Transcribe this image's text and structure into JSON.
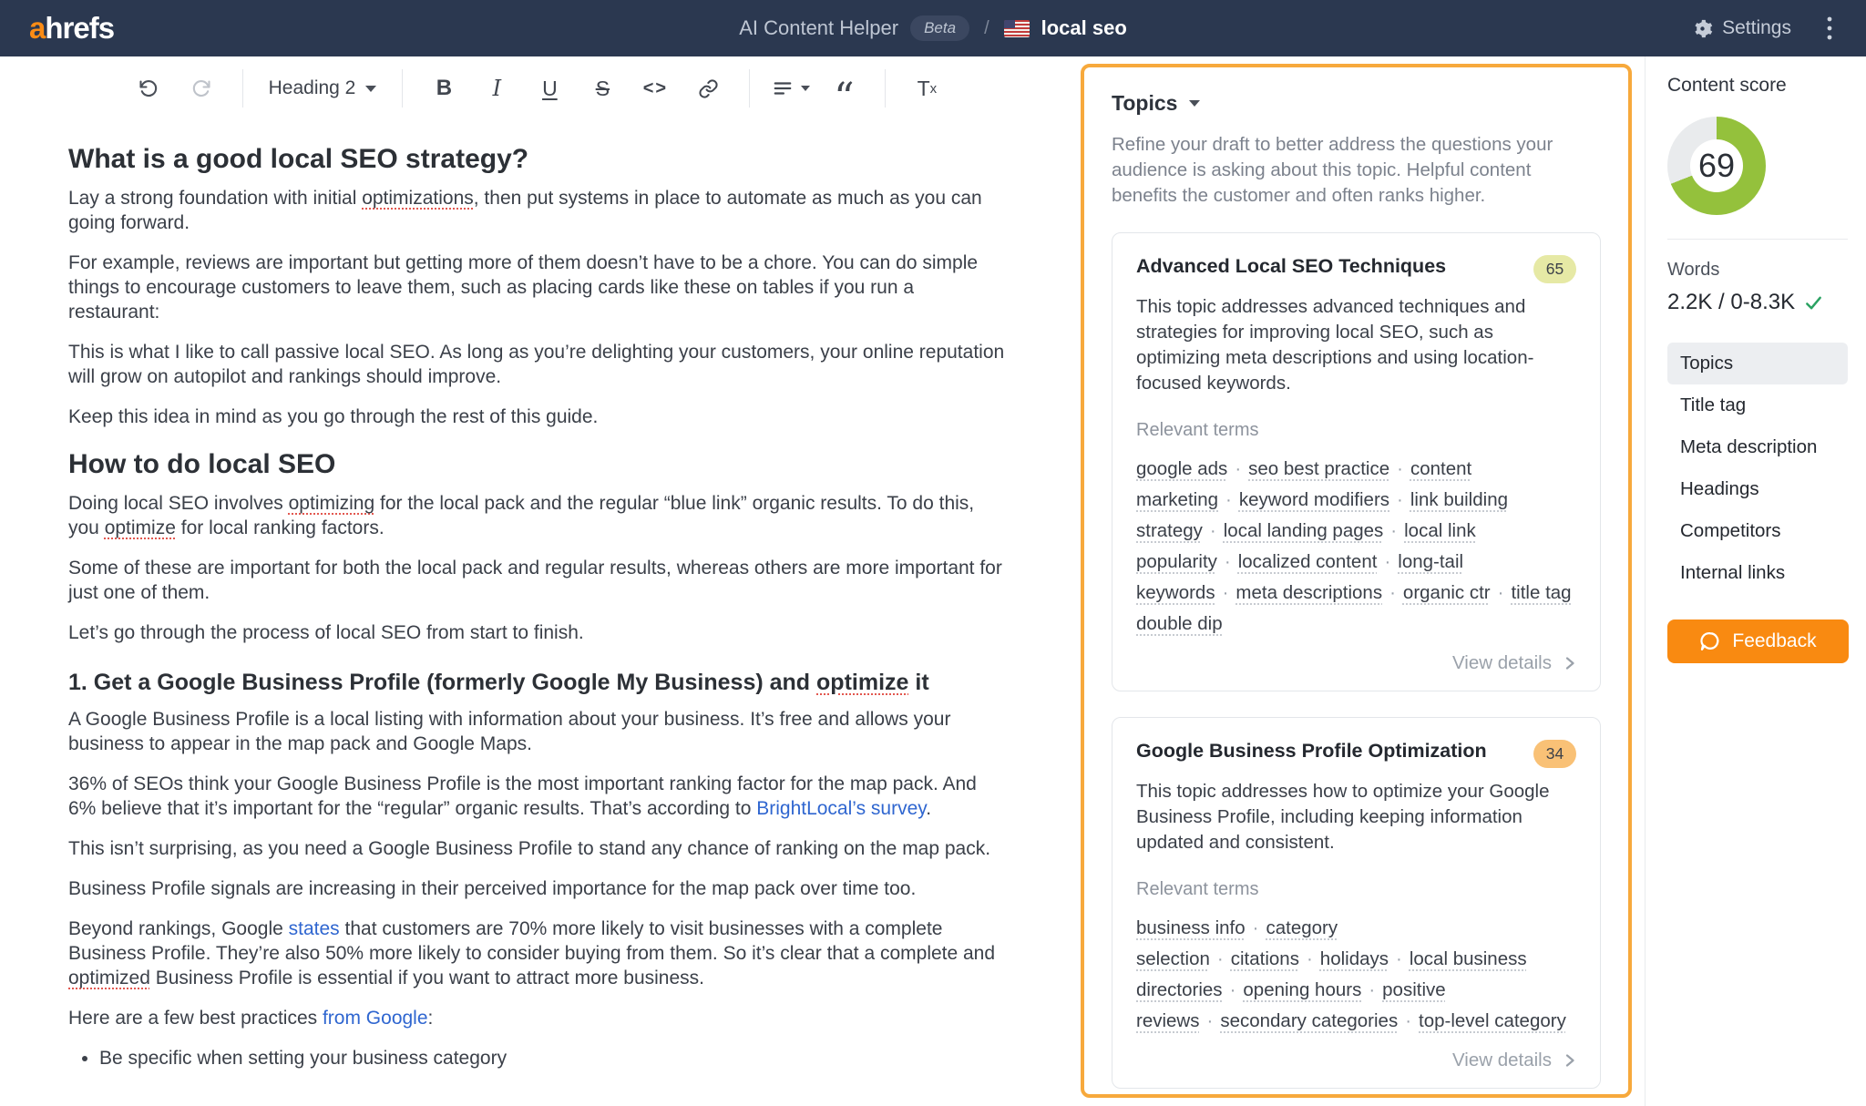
{
  "colors": {
    "navbar_bg": "#2b3850",
    "brand_orange": "#fb8c15",
    "panel_border_orange": "#f7a93c",
    "feedback_orange": "#f98a11",
    "link_blue": "#2f66d0",
    "donut_green": "#94c13c",
    "donut_gray": "#e9ebed",
    "check_green": "#2aa262",
    "spell_red": "#e2574f"
  },
  "navbar": {
    "logo_accent": "a",
    "logo_rest": "hrefs",
    "app_title": "AI Content Helper",
    "beta_label": "Beta",
    "breadcrumb_separator": "/",
    "doc_title": "local seo",
    "settings_label": "Settings"
  },
  "icons": {
    "undo": "undo-arrow-icon",
    "redo": "redo-arrow-icon",
    "heading_caret": "chevron-down-icon",
    "link": "chain-link-icon",
    "align": "align-text-icon",
    "settings": "gear-icon",
    "more": "kebab-menu-icon",
    "words_check": "check-icon",
    "feedback": "speech-bubble-icon",
    "view_details": "chevron-right-icon",
    "flag": "us-flag-icon"
  },
  "toolbar": {
    "heading_label": "Heading 2",
    "bold_glyph": "B",
    "italic_glyph": "I",
    "underline_glyph": "U",
    "strikethrough_glyph": "S",
    "code_glyph": "<>",
    "quote_glyph": "“",
    "clear_format_main": "T",
    "clear_format_sub": "x"
  },
  "article": {
    "blocks": [
      {
        "type": "h2",
        "segments": [
          {
            "t": "What is a good local SEO strategy?"
          }
        ]
      },
      {
        "type": "p",
        "segments": [
          {
            "t": "Lay a strong foundation with initial "
          },
          {
            "t": "optimizations",
            "s": "spell"
          },
          {
            "t": ", then put systems in place to automate as much as you can going forward."
          }
        ]
      },
      {
        "type": "p",
        "segments": [
          {
            "t": "For example, reviews are important but getting more of them doesn’t have to be a chore. You can do simple things to encourage customers to leave them, such as placing cards like these on tables if you run a restaurant:"
          }
        ]
      },
      {
        "type": "p",
        "segments": [
          {
            "t": "This is what I like to call passive local SEO. As long as you’re delighting your customers, your online reputation will grow on autopilot and rankings should improve."
          }
        ]
      },
      {
        "type": "p",
        "segments": [
          {
            "t": "Keep this idea in mind as you go through the rest of this guide."
          }
        ]
      },
      {
        "type": "h2",
        "segments": [
          {
            "t": "How to do local SEO"
          }
        ]
      },
      {
        "type": "p",
        "segments": [
          {
            "t": "Doing local SEO involves "
          },
          {
            "t": "optimizing",
            "s": "spell"
          },
          {
            "t": " for the local pack and the regular “blue link” organic results. To do this, you "
          },
          {
            "t": "optimize",
            "s": "spell"
          },
          {
            "t": " for local ranking factors."
          }
        ]
      },
      {
        "type": "p",
        "segments": [
          {
            "t": "Some of these are important for both the local pack and regular results, whereas others are more important for just one of them."
          }
        ]
      },
      {
        "type": "p",
        "segments": [
          {
            "t": "Let’s go through the process of local SEO from start to finish."
          }
        ]
      },
      {
        "type": "h3",
        "segments": [
          {
            "t": "1. Get a Google Business Profile (formerly Google My Business) and "
          },
          {
            "t": "optimize",
            "s": "spell"
          },
          {
            "t": " it"
          }
        ]
      },
      {
        "type": "p",
        "segments": [
          {
            "t": "A Google Business Profile is a local listing with information about your business. It’s free and allows your business to appear in the map pack and Google Maps."
          }
        ]
      },
      {
        "type": "p",
        "segments": [
          {
            "t": "36% of SEOs think your Google Business Profile is the most important ranking factor for the map pack. And 6% believe that it’s important for the “regular” organic results. That’s according to "
          },
          {
            "t": "BrightLocal’s survey",
            "s": "link"
          },
          {
            "t": "."
          }
        ]
      },
      {
        "type": "p",
        "segments": [
          {
            "t": "This isn’t surprising, as you need a Google Business Profile to stand any chance of ranking on the map pack."
          }
        ]
      },
      {
        "type": "p",
        "segments": [
          {
            "t": "Business Profile signals are increasing in their perceived importance for the map pack over time too."
          }
        ]
      },
      {
        "type": "p",
        "segments": [
          {
            "t": "Beyond rankings, Google "
          },
          {
            "t": "states",
            "s": "link"
          },
          {
            "t": " that customers are 70% more likely to visit businesses with a complete Business Profile. They’re also 50% more likely to consider buying from them. So it’s clear that a complete and "
          },
          {
            "t": "optimized",
            "s": "spell"
          },
          {
            "t": " Business Profile is essential if you want to attract more business."
          }
        ]
      },
      {
        "type": "p",
        "segments": [
          {
            "t": "Here are a few best practices "
          },
          {
            "t": "from Google",
            "s": "link"
          },
          {
            "t": ":"
          }
        ]
      },
      {
        "type": "ul",
        "items": [
          "Be specific when setting your business category"
        ]
      }
    ]
  },
  "topics_panel": {
    "title": "Topics",
    "description": "Refine your draft to better address the questions your audience is asking about this topic. Helpful content benefits the customer and often ranks higher.",
    "cards": [
      {
        "title": "Advanced Local SEO Techniques",
        "score": "65",
        "score_color": "#e6e9a5",
        "description": "This topic addresses advanced techniques and strategies for improving local SEO, such as optimizing meta descriptions and using location-focused keywords.",
        "relevant_terms_label": "Relevant terms",
        "terms": [
          "google ads",
          "seo best practice",
          "content marketing",
          "keyword modifiers",
          "link building strategy",
          "local landing pages",
          "local link popularity",
          "localized content",
          "long-tail keywords",
          "meta descriptions",
          "organic ctr",
          "title tag double dip"
        ],
        "view_details_label": "View details"
      },
      {
        "title": "Google Business Profile Optimization",
        "score": "34",
        "score_color": "#f9c176",
        "description": "This topic addresses how to optimize your Google Business Profile, including keeping information updated and consistent.",
        "relevant_terms_label": "Relevant terms",
        "terms": [
          "business info",
          "category selection",
          "citations",
          "holidays",
          "local business directories",
          "opening hours",
          "positive reviews",
          "secondary categories",
          "top-level category"
        ],
        "view_details_label": "View details"
      }
    ]
  },
  "sidebar": {
    "content_score_label": "Content score",
    "score": 69,
    "words_label": "Words",
    "words_value": "2.2K / 0-8.3K",
    "nav_items": [
      {
        "label": "Topics",
        "active": true
      },
      {
        "label": "Title tag",
        "active": false
      },
      {
        "label": "Meta description",
        "active": false
      },
      {
        "label": "Headings",
        "active": false
      },
      {
        "label": "Competitors",
        "active": false
      },
      {
        "label": "Internal links",
        "active": false
      }
    ],
    "feedback_label": "Feedback"
  }
}
